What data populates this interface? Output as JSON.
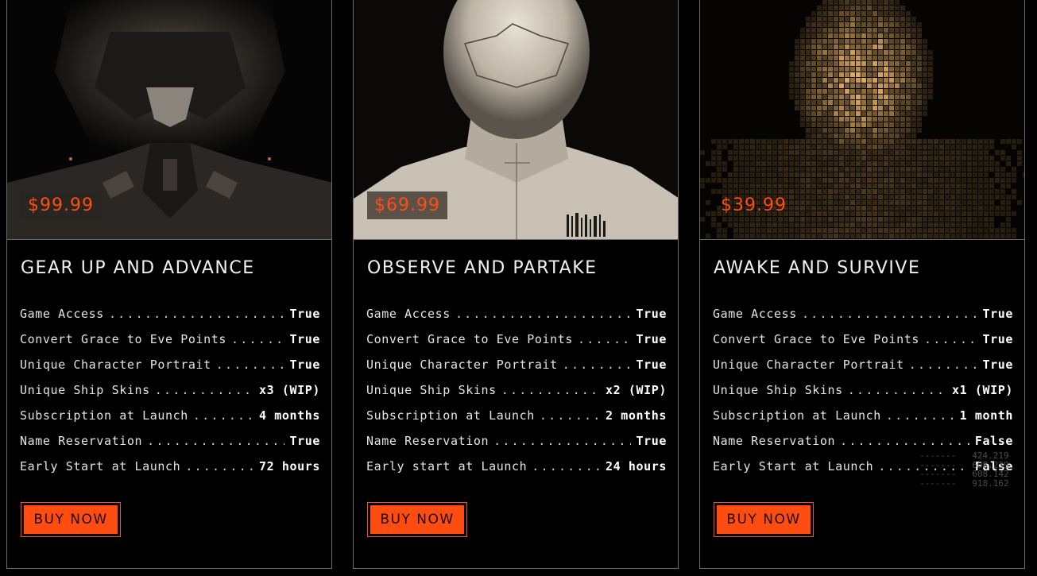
{
  "cards": [
    {
      "price": "$99.99",
      "title": "GEAR UP AND ADVANCE",
      "features": [
        {
          "label": "Game Access",
          "value": "True"
        },
        {
          "label": "Convert Grace to Eve Points",
          "value": "True"
        },
        {
          "label": "Unique Character Portrait",
          "value": "True"
        },
        {
          "label": "Unique Ship Skins",
          "value": "x3 (WIP)"
        },
        {
          "label": "Subscription at Launch",
          "value": "4 months"
        },
        {
          "label": "Name Reservation",
          "value": "True"
        },
        {
          "label": "Early Start at Launch",
          "value": "72 hours"
        }
      ],
      "button": "BUY NOW"
    },
    {
      "price": "$69.99",
      "title": "OBSERVE AND PARTAKE",
      "features": [
        {
          "label": "Game Access",
          "value": "True"
        },
        {
          "label": "Convert Grace to Eve Points",
          "value": "True"
        },
        {
          "label": "Unique Character Portrait",
          "value": "True"
        },
        {
          "label": "Unique Ship Skins",
          "value": "x2 (WIP)"
        },
        {
          "label": "Subscription at Launch",
          "value": "2 months"
        },
        {
          "label": "Name Reservation",
          "value": "True"
        },
        {
          "label": "Early start at Launch",
          "value": "24 hours"
        }
      ],
      "button": "BUY NOW"
    },
    {
      "price": "$39.99",
      "title": "AWAKE AND SURVIVE",
      "features": [
        {
          "label": "Game Access",
          "value": "True"
        },
        {
          "label": "Convert Grace to Eve Points",
          "value": "True"
        },
        {
          "label": "Unique Character Portrait",
          "value": "True"
        },
        {
          "label": "Unique Ship Skins",
          "value": "x1 (WIP)"
        },
        {
          "label": "Subscription at Launch",
          "value": "1 month"
        },
        {
          "label": "Name Reservation",
          "value": "False"
        },
        {
          "label": "Early Start at Launch",
          "value": "False"
        }
      ],
      "button": "BUY NOW"
    }
  ],
  "readout": {
    "rows": [
      {
        "dash": "-------",
        "num": "424.219"
      },
      {
        "dash": "-------",
        "num": "608.239"
      },
      {
        "dash": "-------",
        "num": "608.142"
      },
      {
        "dash": "-------",
        "num": "918.162"
      }
    ]
  },
  "colors": {
    "accent": "#ff4d12",
    "background": "#000000",
    "border": "#6a6a6a"
  }
}
